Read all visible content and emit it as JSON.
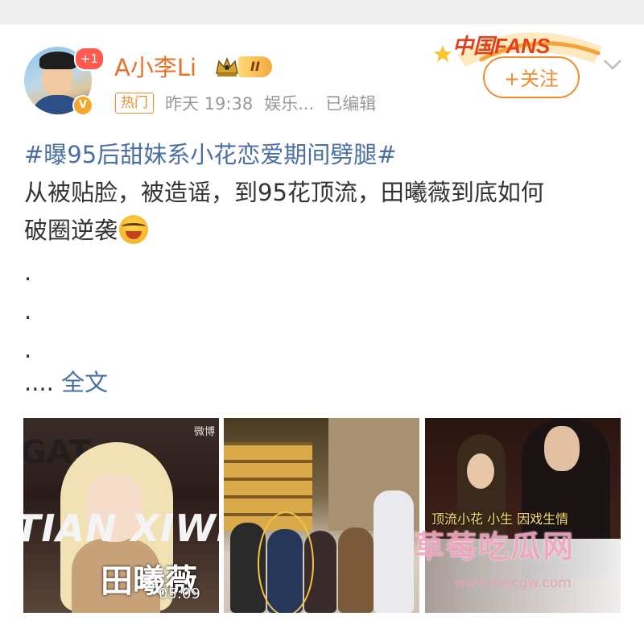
{
  "header": {
    "username": "A小李Li",
    "level_badge": "II",
    "notification_count": "+1",
    "hot_tag": "热门",
    "time": "昨天 19:38",
    "source": "娱乐...",
    "edited": "已编辑",
    "follow_label": "+关注",
    "fans_banner": "中国FANS"
  },
  "post": {
    "topic": "#曝95后甜妹系小花恋爱期间劈腿#",
    "line1": "从被贴脸，被造谣，到95花顶流，田曦薇到底如何",
    "line2": "破圈逆袭",
    "dots": [
      ".",
      ".",
      "."
    ],
    "ellipsis": "....",
    "full_text_link": "全文"
  },
  "images": [
    {
      "overlay_name": "田曦薇",
      "overlay_text_bg1": "GAT",
      "overlay_text_bg2": "TIAN XIWE",
      "duration": "05:09",
      "watermark": "微博"
    },
    {},
    {
      "caption": "顶流小花 小生 因戏生情"
    }
  ],
  "watermark": {
    "title": "草莓吃瓜网",
    "url": "www.cmcgw.com"
  },
  "colors": {
    "username": "#e8712a",
    "topic_link": "#4a6fa3",
    "follow": "#f28a2e",
    "meta": "#999999"
  }
}
